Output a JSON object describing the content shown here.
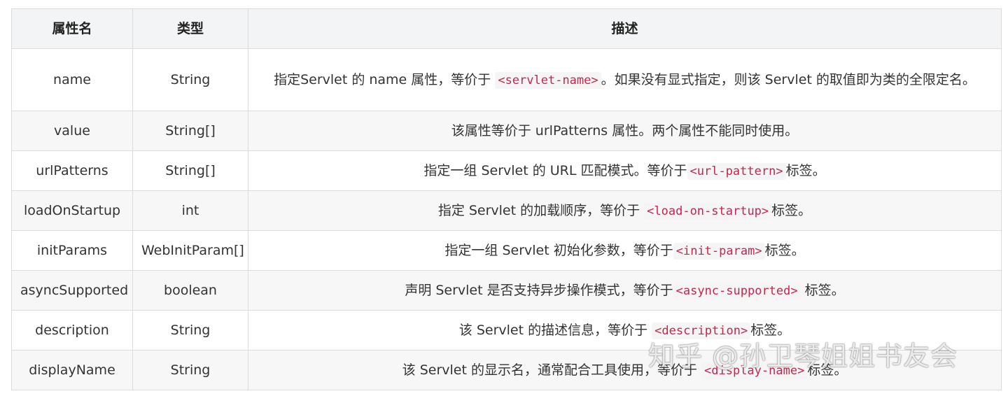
{
  "table": {
    "headers": [
      "属性名",
      "类型",
      "描述"
    ],
    "rows": [
      {
        "name": "name",
        "type": "String",
        "desc_before": "指定Servlet 的 name 属性，等价于 ",
        "code": "<servlet-name>",
        "desc_after": "。如果没有显式指定，则该 Servlet 的取值即为类的全限定名。"
      },
      {
        "name": "value",
        "type": "String[]",
        "desc_before": "该属性等价于 urlPatterns 属性。两个属性不能同时使用。",
        "code": "",
        "desc_after": ""
      },
      {
        "name": "urlPatterns",
        "type": "String[]",
        "desc_before": "指定一组 Servlet 的 URL 匹配模式。等价于",
        "code": "<url-pattern>",
        "desc_after": "标签。"
      },
      {
        "name": "loadOnStartup",
        "type": "int",
        "desc_before": "指定 Servlet 的加载顺序，等价于 ",
        "code": "<load-on-startup>",
        "desc_after": "标签。"
      },
      {
        "name": "initParams",
        "type": "WebInitParam[]",
        "desc_before": "指定一组 Servlet 初始化参数，等价于",
        "code": "<init-param>",
        "desc_after": "标签。"
      },
      {
        "name": "asyncSupported",
        "type": "boolean",
        "desc_before": "声明 Servlet 是否支持异步操作模式，等价于",
        "code": "<async-supported>",
        "desc_after": " 标签。"
      },
      {
        "name": "description",
        "type": "String",
        "desc_before": "该 Servlet 的描述信息，等价于 ",
        "code": "<description>",
        "desc_after": "标签。"
      },
      {
        "name": "displayName",
        "type": "String",
        "desc_before": "该 Servlet 的显示名，通常配合工具使用，等价于 ",
        "code": "<display-name>",
        "desc_after": "标签。"
      }
    ]
  },
  "watermark": "知乎 @孙卫琴姐姐书友会"
}
